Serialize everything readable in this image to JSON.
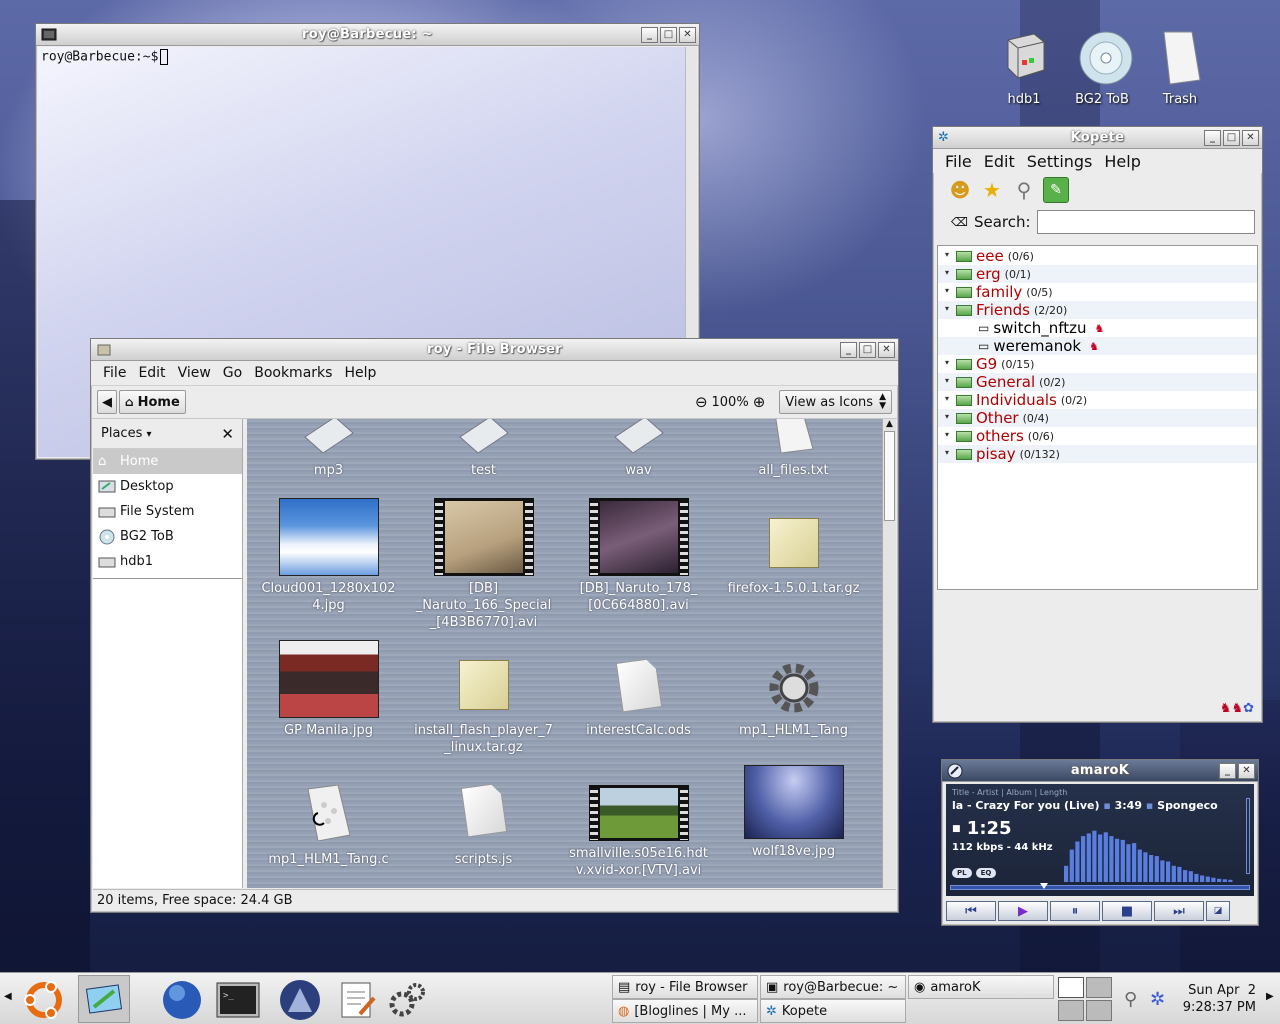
{
  "desktop_icons": [
    {
      "label": "hdb1",
      "icon": "hard-drive-icon"
    },
    {
      "label": "BG2 ToB",
      "icon": "cd-disc-icon"
    },
    {
      "label": "Trash",
      "icon": "trash-icon"
    }
  ],
  "terminal": {
    "title": "roy@Barbecue: ~",
    "prompt": "roy@Barbecue:~$"
  },
  "file_browser": {
    "title": "roy - File Browser",
    "menu": [
      "File",
      "Edit",
      "View",
      "Go",
      "Bookmarks",
      "Help"
    ],
    "location": "Home",
    "zoom": "100%",
    "view_mode": "View as Icons",
    "sidebar_title": "Places",
    "places": [
      "Home",
      "Desktop",
      "File System",
      "BG2 ToB",
      "hdb1"
    ],
    "files": [
      {
        "name": "mp3",
        "kind": "folder"
      },
      {
        "name": "test",
        "kind": "folder"
      },
      {
        "name": "wav",
        "kind": "folder"
      },
      {
        "name": "all_files.txt",
        "kind": "text"
      },
      {
        "name": "Cloud001_1280x1024.jpg",
        "kind": "image",
        "line1": "Cloud001_1280x102",
        "line2": "4.jpg"
      },
      {
        "name": "[DB]_Naruto_166_Special_[4B3B6770].avi",
        "kind": "video",
        "line1": "[DB]",
        "line2": "_Naruto_166_Special",
        "line3": "_[4B3B6770].avi"
      },
      {
        "name": "[DB]_Naruto_178_[0C664880].avi",
        "kind": "video",
        "line1": "[DB]_Naruto_178_",
        "line2": "[0C664880].avi"
      },
      {
        "name": "firefox-1.5.0.1.tar.gz",
        "kind": "archive"
      },
      {
        "name": "GP Manila.jpg",
        "kind": "image"
      },
      {
        "name": "install_flash_player_7_linux.tar.gz",
        "kind": "archive",
        "line1": "install_flash_player_7",
        "line2": "_linux.tar.gz"
      },
      {
        "name": "interestCalc.ods",
        "kind": "spreadsheet"
      },
      {
        "name": "mp1_HLM1_Tang",
        "kind": "executable"
      },
      {
        "name": "mp1_HLM1_Tang.c",
        "kind": "source"
      },
      {
        "name": "scripts.js",
        "kind": "script"
      },
      {
        "name": "smallville.s05e16.hdtv.xvid-xor.[VTV].avi",
        "kind": "video",
        "line1": "smallville.s05e16.hdt",
        "line2": "v.xvid-xor.[VTV].avi"
      },
      {
        "name": "wolf18ve.jpg",
        "kind": "image"
      }
    ],
    "status": "20 items, Free space: 24.4 GB"
  },
  "kopete": {
    "title": "Kopete",
    "menu": [
      "File",
      "Edit",
      "Settings",
      "Help"
    ],
    "search_label": "Search:",
    "groups": [
      {
        "name": "eee",
        "count": "(0/6)"
      },
      {
        "name": "erg",
        "count": "(0/1)"
      },
      {
        "name": "family",
        "count": "(0/5)"
      },
      {
        "name": "Friends",
        "count": "(2/20)"
      },
      {
        "name": "switch_nftzu",
        "count": "",
        "contact": true
      },
      {
        "name": "weremanok",
        "count": "",
        "contact": true
      },
      {
        "name": "G9",
        "count": "(0/15)"
      },
      {
        "name": "General",
        "count": "(0/2)"
      },
      {
        "name": "Individuals",
        "count": "(0/2)"
      },
      {
        "name": "Other",
        "count": "(0/4)"
      },
      {
        "name": "others",
        "count": "(0/6)"
      },
      {
        "name": "pisay",
        "count": "(0/132)"
      }
    ]
  },
  "amarok": {
    "title": "amaroK",
    "header": "Title - Artist | Album | Length",
    "track": "la - Crazy For you (Live)",
    "length": "3:49",
    "artist": "Spongeco",
    "time": "1:25",
    "bitrate": "112 kbps - 44 kHz",
    "pl_label": "PL",
    "eq_label": "EQ",
    "progress": 0.3,
    "spectrum": [
      0.3,
      0.6,
      0.75,
      0.85,
      0.9,
      0.95,
      0.88,
      0.92,
      0.85,
      0.8,
      0.78,
      0.7,
      0.72,
      0.6,
      0.55,
      0.5,
      0.48,
      0.4,
      0.38,
      0.3,
      0.28,
      0.22,
      0.2,
      0.15,
      0.12,
      0.1,
      0.08,
      0.06,
      0.05,
      0.04
    ]
  },
  "taskbar": {
    "tasks": [
      {
        "label": "roy - File Browser",
        "icon": "file-browser-icon"
      },
      {
        "label": "roy@Barbecue: ~",
        "icon": "terminal-icon"
      },
      {
        "label": "amaroK",
        "icon": "amarok-icon"
      },
      {
        "label": "[Bloglines | My ...",
        "icon": "firefox-icon"
      },
      {
        "label": "Kopete",
        "icon": "kopete-icon"
      }
    ],
    "clock_date": "Sun Apr  2",
    "clock_time": "9:28:37 PM"
  },
  "colors": {
    "group_name": "#b00000",
    "icon_bg_light": "#a1acbe",
    "amarok_display": "#1b2438"
  }
}
